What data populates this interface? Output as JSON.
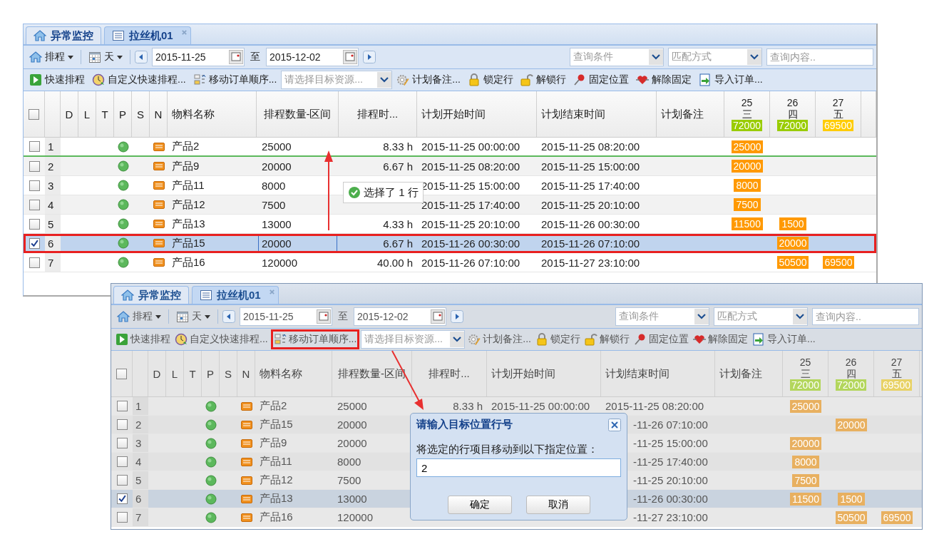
{
  "panels": [
    {
      "masked": false,
      "tabs": [
        {
          "label": "异常监控",
          "selected": false,
          "closable": false
        },
        {
          "label": "拉丝机01",
          "selected": true,
          "closable": true
        }
      ],
      "toolbar1": {
        "schedule_menu": "排程",
        "view_menu": "天",
        "date_from": "2015-11-25",
        "to_label": "至",
        "date_to": "2015-12-02",
        "query_placeholder": "查询条件",
        "match_placeholder": "匹配方式",
        "search_placeholder": "查询内容.."
      },
      "toolbar2": [
        {
          "kind": "button",
          "label": "快速排程",
          "highlighted": false
        },
        {
          "kind": "button",
          "label": "自定义快速排程...",
          "highlighted": false
        },
        {
          "kind": "button",
          "label": "移动订单顺序...",
          "highlighted": false
        },
        {
          "kind": "select",
          "placeholder": "请选择目标资源..."
        },
        {
          "kind": "button",
          "label": "计划备注...",
          "highlighted": false
        },
        {
          "kind": "button",
          "label": "锁定行",
          "highlighted": false
        },
        {
          "kind": "button",
          "label": "解锁行",
          "highlighted": false
        },
        {
          "kind": "button",
          "label": "固定位置",
          "highlighted": false
        },
        {
          "kind": "button",
          "label": "解除固定",
          "highlighted": false
        },
        {
          "kind": "button",
          "label": "导入订单...",
          "highlighted": false
        }
      ],
      "select_all_checked": false,
      "columns": [
        "D",
        "L",
        "T",
        "P",
        "S",
        "N",
        "物料名称",
        "排程数量-区间",
        "排程时...",
        "计划开始时间",
        "计划结束时间",
        "计划备注"
      ],
      "days": [
        {
          "date": "25",
          "weekday": "三",
          "total": "72000",
          "color": "#99cc00"
        },
        {
          "date": "26",
          "weekday": "四",
          "total": "72000",
          "color": "#99cc00"
        },
        {
          "date": "27",
          "weekday": "五",
          "total": "69500",
          "color": "#ffcc00"
        }
      ],
      "rows": [
        {
          "num": "1",
          "checked": false,
          "selected": false,
          "outlined": false,
          "qty_editing": false,
          "drop_line_below": true,
          "name": "产品2",
          "qty": "25000",
          "duration": "8.33 h",
          "start": "2015-11-25 00:00:00",
          "end": "2015-11-25 08:20:00",
          "day_1": "25000"
        },
        {
          "num": "2",
          "checked": false,
          "selected": false,
          "outlined": false,
          "qty_editing": false,
          "drop_line_below": false,
          "name": "产品9",
          "qty": "20000",
          "duration": "6.67 h",
          "start": "2015-11-25 08:20:00",
          "end": "2015-11-25 15:00:00",
          "day_1": "20000"
        },
        {
          "num": "3",
          "checked": false,
          "selected": false,
          "outlined": false,
          "qty_editing": false,
          "drop_line_below": false,
          "name": "产品11",
          "qty": "8000",
          "start": "2015-11-25 15:00:00",
          "end": "2015-11-25 17:40:00",
          "day_1": "8000"
        },
        {
          "num": "4",
          "checked": false,
          "selected": false,
          "outlined": false,
          "qty_editing": false,
          "drop_line_below": false,
          "name": "产品12",
          "qty": "7500",
          "start": "2015-11-25 17:40:00",
          "end": "2015-11-25 20:10:00",
          "day_1": "7500"
        },
        {
          "num": "5",
          "checked": false,
          "selected": false,
          "outlined": false,
          "qty_editing": false,
          "drop_line_below": false,
          "name": "产品13",
          "qty": "13000",
          "duration": "4.33 h",
          "start": "2015-11-25 20:10:00",
          "end": "2015-11-26 00:30:00",
          "day_1": "11500",
          "day_2": "1500"
        },
        {
          "num": "6",
          "checked": true,
          "selected": true,
          "outlined": true,
          "qty_editing": true,
          "drop_line_below": false,
          "name": "产品15",
          "qty": "20000",
          "duration": "6.67 h",
          "start": "2015-11-26 00:30:00",
          "end": "2015-11-26 07:10:00",
          "day_2": "20000"
        },
        {
          "num": "7",
          "checked": false,
          "selected": false,
          "outlined": false,
          "qty_editing": false,
          "drop_line_below": false,
          "name": "产品16",
          "qty": "120000",
          "duration": "40.00 h",
          "start": "2015-11-26 07:10:00",
          "end": "2015-11-27 23:10:00",
          "day_2": "50500",
          "day_3": "69500"
        }
      ],
      "tooltip": {
        "text": "选择了 1 行"
      }
    },
    {
      "masked": true,
      "tabs": [
        {
          "label": "异常监控",
          "selected": false,
          "closable": false
        },
        {
          "label": "拉丝机01",
          "selected": true,
          "closable": true
        }
      ],
      "toolbar1": {
        "schedule_menu": "排程",
        "view_menu": "天",
        "date_from": "2015-11-25",
        "to_label": "至",
        "date_to": "2015-12-02",
        "query_placeholder": "查询条件",
        "match_placeholder": "匹配方式",
        "search_placeholder": "查询内容.."
      },
      "toolbar2": [
        {
          "kind": "button",
          "label": "快速排程",
          "highlighted": false
        },
        {
          "kind": "button",
          "label": "自定义快速排程...",
          "highlighted": false
        },
        {
          "kind": "button",
          "label": "移动订单顺序...",
          "highlighted": true
        },
        {
          "kind": "select",
          "placeholder": "请选择目标资源..."
        },
        {
          "kind": "button",
          "label": "计划备注...",
          "highlighted": false
        },
        {
          "kind": "button",
          "label": "锁定行",
          "highlighted": false
        },
        {
          "kind": "button",
          "label": "解锁行",
          "highlighted": false
        },
        {
          "kind": "button",
          "label": "固定位置",
          "highlighted": false
        },
        {
          "kind": "button",
          "label": "解除固定",
          "highlighted": false
        },
        {
          "kind": "button",
          "label": "导入订单...",
          "highlighted": false
        }
      ],
      "select_all_checked": false,
      "columns": [
        "D",
        "L",
        "T",
        "P",
        "S",
        "N",
        "物料名称",
        "排程数量-区间",
        "排程时...",
        "计划开始时间",
        "计划结束时间",
        "计划备注"
      ],
      "days": [
        {
          "date": "25",
          "weekday": "三",
          "total": "72000",
          "color": "#b3d65c"
        },
        {
          "date": "26",
          "weekday": "四",
          "total": "72000",
          "color": "#b3d65c"
        },
        {
          "date": "27",
          "weekday": "五",
          "total": "69500",
          "color": "#e8d266"
        }
      ],
      "rows": [
        {
          "num": "1",
          "checked": false,
          "selected": false,
          "covered": false,
          "name": "产品2",
          "qty": "25000",
          "duration": "8.33 h",
          "start": "2015-11-25 00:00:00",
          "end": "2015-11-25 08:20:00",
          "day_1": "25000"
        },
        {
          "num": "2",
          "checked": false,
          "selected": false,
          "covered": true,
          "name": "产品15",
          "qty": "20000",
          "end": "-11-26 07:10:00",
          "day_2": "20000"
        },
        {
          "num": "3",
          "checked": false,
          "selected": false,
          "covered": true,
          "name": "产品9",
          "qty": "20000",
          "end": "-11-25 15:00:00",
          "day_1": "20000"
        },
        {
          "num": "4",
          "checked": false,
          "selected": false,
          "covered": true,
          "name": "产品11",
          "qty": "8000",
          "end": "-11-25 17:40:00",
          "day_1": "8000"
        },
        {
          "num": "5",
          "checked": false,
          "selected": false,
          "covered": true,
          "name": "产品12",
          "qty": "7500",
          "end": "-11-25 20:10:00",
          "day_1": "7500"
        },
        {
          "num": "6",
          "checked": true,
          "selected": true,
          "covered": true,
          "name": "产品13",
          "qty": "13000",
          "end": "-11-26 00:30:00",
          "day_1": "11500",
          "day_2": "1500"
        },
        {
          "num": "7",
          "checked": false,
          "selected": false,
          "covered": true,
          "name": "产品16",
          "qty": "120000",
          "end": "-11-27 23:10:00",
          "day_2": "50500",
          "day_3": "69500"
        }
      ],
      "dialog": {
        "title": "请输入目标位置行号",
        "prompt": "将选定的行项目移动到以下指定位置：",
        "value": "2",
        "buttons": [
          "确定",
          "取消"
        ]
      }
    }
  ]
}
